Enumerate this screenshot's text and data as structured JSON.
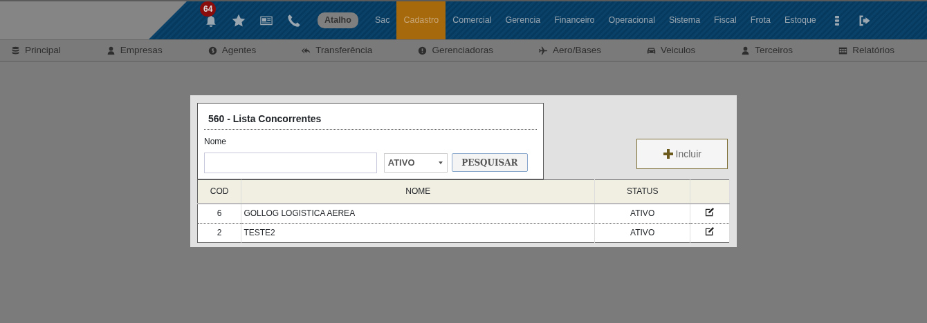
{
  "top_bar": {
    "notification_count": "64",
    "shortcut": "Atalho",
    "menu": [
      {
        "label": "Sac",
        "selected": false
      },
      {
        "label": "Cadastro",
        "selected": true
      },
      {
        "label": "Comercial",
        "selected": false
      },
      {
        "label": "Gerencia",
        "selected": false
      },
      {
        "label": "Financeiro",
        "selected": false
      },
      {
        "label": "Operacional",
        "selected": false
      },
      {
        "label": "Sistema",
        "selected": false
      },
      {
        "label": "Fiscal",
        "selected": false
      },
      {
        "label": "Frota",
        "selected": false
      },
      {
        "label": "Estoque",
        "selected": false
      }
    ]
  },
  "sub_nav": [
    "Principal",
    "Empresas",
    "Agentes",
    "Transferência",
    "Gerenciadoras",
    "Aero/Bases",
    "Veiculos",
    "Terceiros",
    "Relatórios"
  ],
  "dialog": {
    "title": "560 - Lista Concorrentes",
    "name_label": "Nome",
    "status_value": "ATIVO",
    "search_button": "PESQUISAR",
    "add_button": "Incluir",
    "table": {
      "columns": [
        "COD",
        "NOME",
        "STATUS"
      ],
      "rows": [
        [
          "6",
          "GOLLOG LOGISTICA AEREA",
          "ATIVO"
        ],
        [
          "2",
          "TESTE2",
          "ATIVO"
        ]
      ]
    }
  }
}
